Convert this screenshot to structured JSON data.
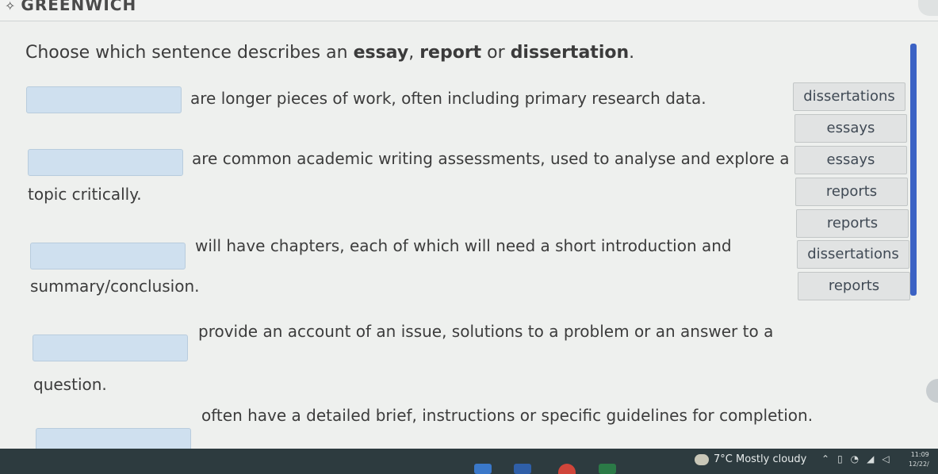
{
  "header": {
    "brand": "GREENWICH"
  },
  "instruction": {
    "prefix": "Choose which sentence describes an ",
    "w1": "essay",
    "sep1": ", ",
    "w2": "report",
    "sep2": " or ",
    "w3": "dissertation",
    "suffix": "."
  },
  "sentences": [
    {
      "line1": "are longer pieces of work, often including primary research data.",
      "line2": ""
    },
    {
      "line1": "are common academic writing assessments, used to analyse and explore a",
      "line2": "topic critically."
    },
    {
      "line1": "will have chapters, each of which will need a short introduction and",
      "line2": "summary/conclusion."
    },
    {
      "line1": "provide an account of an issue, solutions to a problem or an answer to a",
      "line2": "question."
    },
    {
      "line1": "often have a detailed brief, instructions or specific guidelines for completion.",
      "line2": ""
    }
  ],
  "word_bank": [
    "dissertations",
    "essays",
    "essays",
    "reports",
    "reports",
    "dissertations",
    "reports"
  ],
  "taskbar": {
    "weather": "7°C  Mostly cloudy",
    "time": "11:09",
    "date": "12/22/"
  }
}
